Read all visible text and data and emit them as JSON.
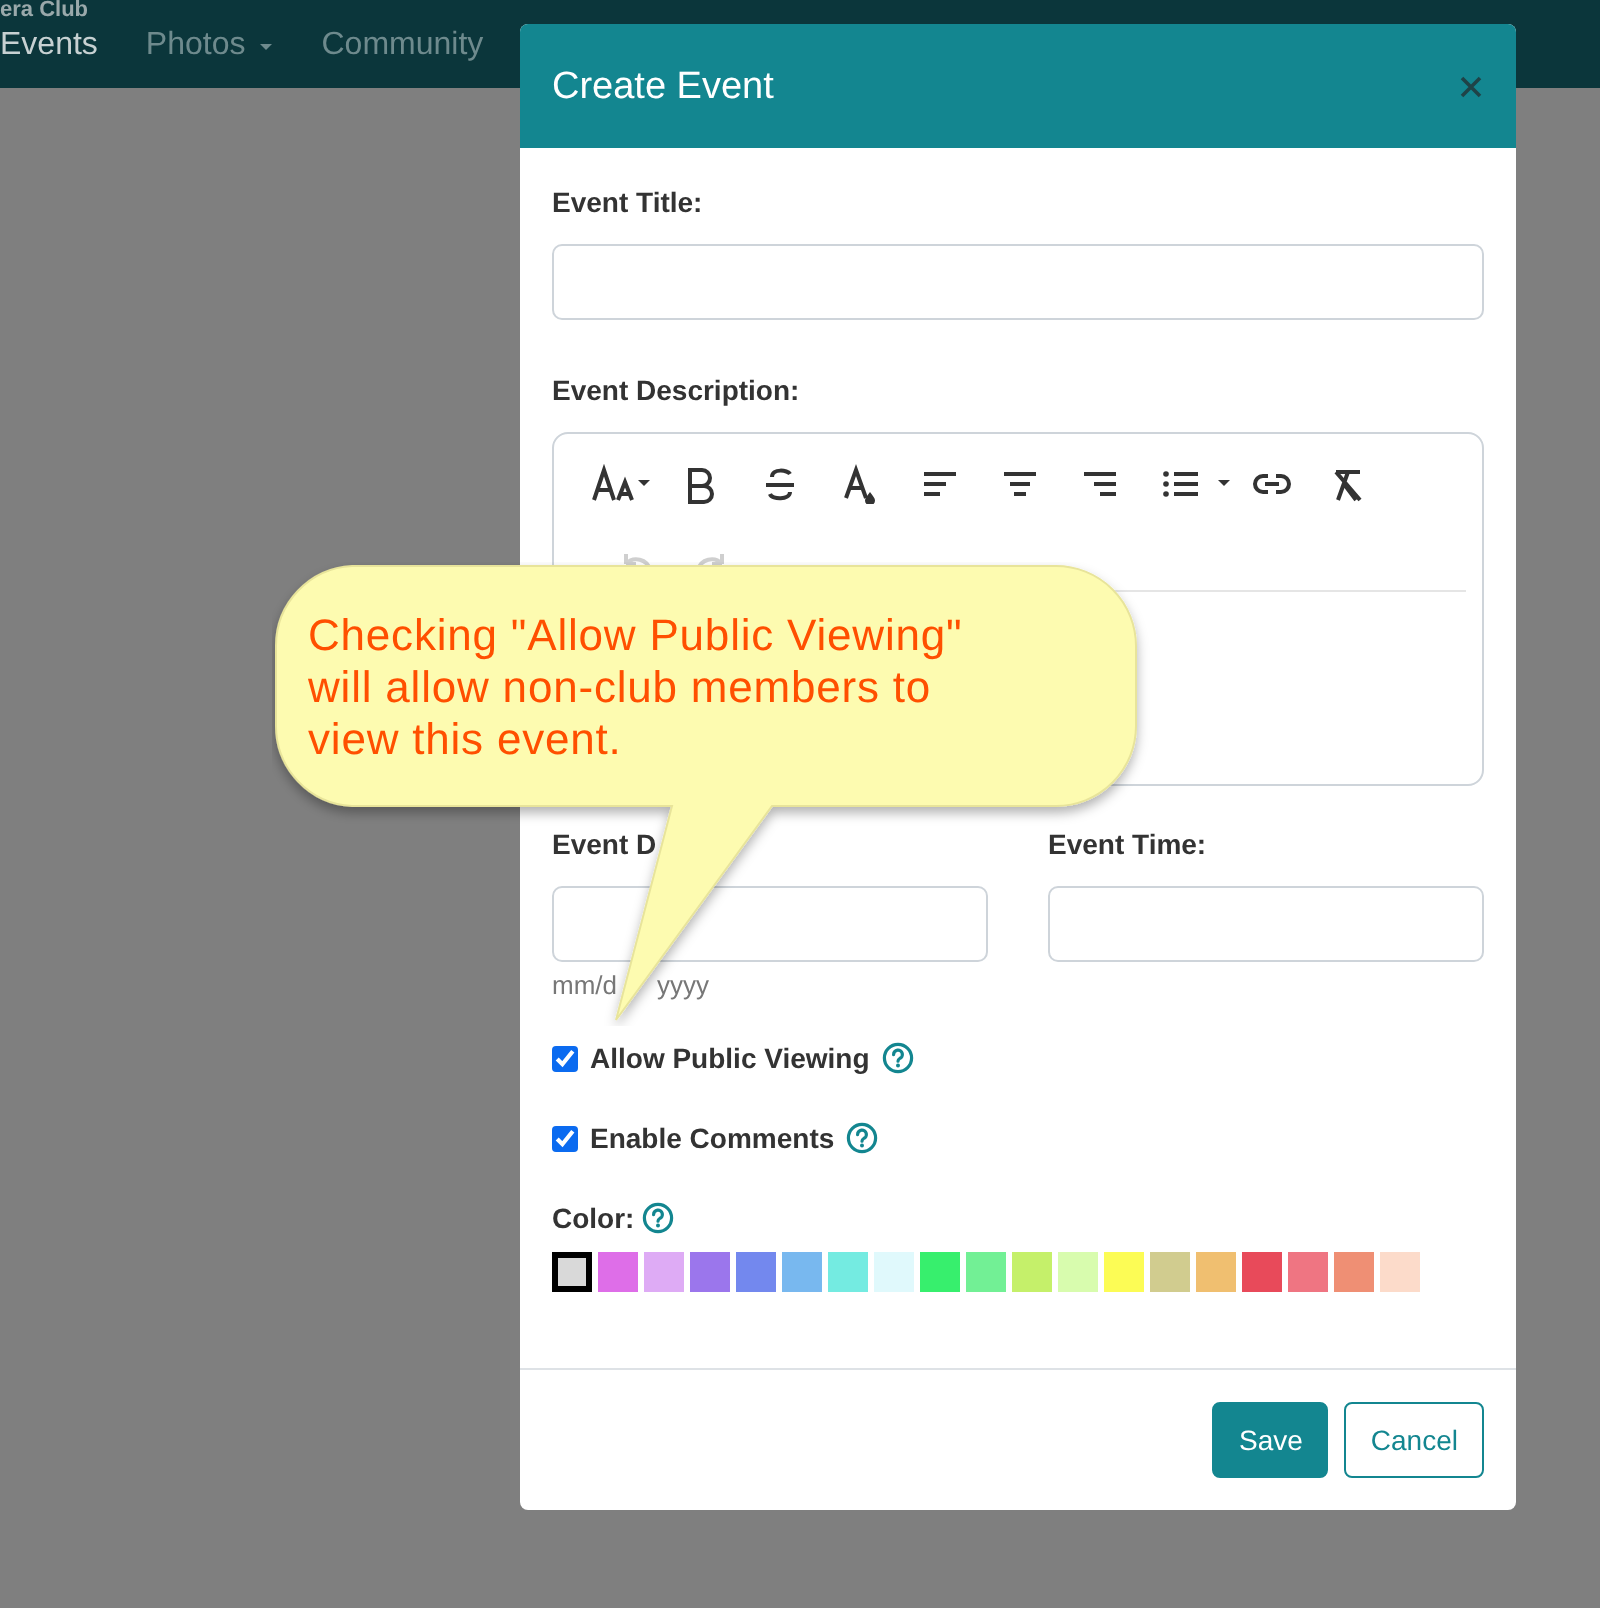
{
  "navbar": {
    "brand": "era Club",
    "items": [
      {
        "label": "Events",
        "selected": true,
        "dropdown": false
      },
      {
        "label": "Photos",
        "selected": false,
        "dropdown": true
      },
      {
        "label": "Community",
        "selected": false,
        "dropdown": false
      }
    ]
  },
  "modal": {
    "title": "Create Event",
    "title_field": {
      "label": "Event Title:"
    },
    "description": {
      "label": "Event Description:",
      "history_buttons": [
        {
          "kind": "undo",
          "disabled": true
        },
        {
          "kind": "redo",
          "disabled": true
        }
      ]
    },
    "date_field": {
      "label": "Event D",
      "hint_parts": [
        "mm/d",
        "yyyy"
      ]
    },
    "time_field": {
      "label": "Event Time:"
    },
    "options": [
      {
        "label": "Allow Public Viewing",
        "checked": true
      },
      {
        "label": "Enable Comments",
        "checked": true
      }
    ],
    "color": {
      "label": "Color:",
      "swatches": [
        {
          "color": "#d9d9d9",
          "selected": true
        },
        {
          "color": "#de6ee8",
          "selected": false
        },
        {
          "color": "#deabf5",
          "selected": false
        },
        {
          "color": "#9b76ec",
          "selected": false
        },
        {
          "color": "#7388ee",
          "selected": false
        },
        {
          "color": "#78b8ef",
          "selected": false
        },
        {
          "color": "#74ebe1",
          "selected": false
        },
        {
          "color": "#e0f9fc",
          "selected": false
        },
        {
          "color": "#37ef6d",
          "selected": false
        },
        {
          "color": "#72f095",
          "selected": false
        },
        {
          "color": "#c5f06a",
          "selected": false
        },
        {
          "color": "#d8fcae",
          "selected": false
        },
        {
          "color": "#fcfc55",
          "selected": false
        },
        {
          "color": "#d1cc8f",
          "selected": false
        },
        {
          "color": "#f0bf70",
          "selected": false
        },
        {
          "color": "#e84a5a",
          "selected": false
        },
        {
          "color": "#ef7582",
          "selected": false
        },
        {
          "color": "#ef8f74",
          "selected": false
        },
        {
          "color": "#fcdbca",
          "selected": false
        }
      ]
    },
    "buttons": [
      {
        "label": "Save",
        "kind": "primary"
      },
      {
        "label": "Cancel",
        "kind": "secondary"
      }
    ]
  },
  "callout": {
    "text": "Checking \"Allow Public Viewing\" will allow non-club members to view this event."
  }
}
